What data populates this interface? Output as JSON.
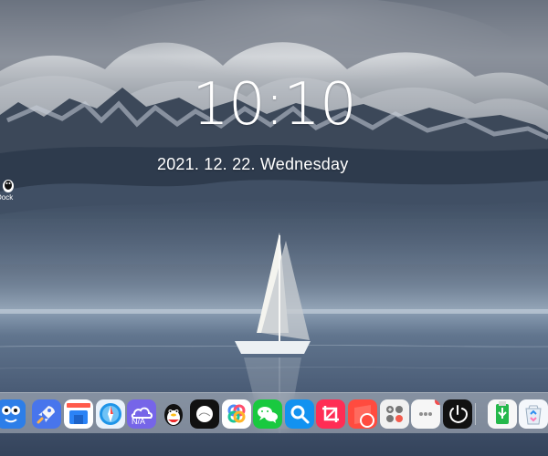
{
  "desktop": {
    "wallpaper": "mountain-lake-sailboat",
    "clock": {
      "time": "10:10",
      "date": "2021. 12. 22. Wednesday"
    },
    "shortcut": {
      "label": "itDock",
      "icon": "penguin-icon"
    }
  },
  "dock": {
    "items": [
      {
        "name": "finder-face-app",
        "icon": "finder-icon"
      },
      {
        "name": "launchpad-app",
        "icon": "rocket-icon"
      },
      {
        "name": "store-app",
        "icon": "store-icon"
      },
      {
        "name": "safari-app",
        "icon": "compass-icon"
      },
      {
        "name": "cloud-app",
        "icon": "cloud-icon",
        "label": "N/A"
      },
      {
        "name": "qq-app",
        "icon": "penguin-icon"
      },
      {
        "name": "circle-app",
        "icon": "white-circle-icon"
      },
      {
        "name": "share-circle-app",
        "icon": "colorful-rings-icon"
      },
      {
        "name": "wechat-app",
        "icon": "chat-bubbles-icon"
      },
      {
        "name": "search-app",
        "icon": "magnifier-icon"
      },
      {
        "name": "crop-app",
        "icon": "crop-icon"
      },
      {
        "name": "notes-app",
        "icon": "red-note-icon"
      },
      {
        "name": "control-center-app",
        "icon": "four-dots-icon"
      },
      {
        "name": "more-app",
        "icon": "more-dots-icon",
        "badge": true
      },
      {
        "name": "power-app",
        "icon": "power-icon"
      },
      {
        "name": "usb-app",
        "icon": "usb-drive-icon"
      },
      {
        "name": "recycle-bin-app",
        "icon": "recycle-bin-icon"
      }
    ]
  }
}
